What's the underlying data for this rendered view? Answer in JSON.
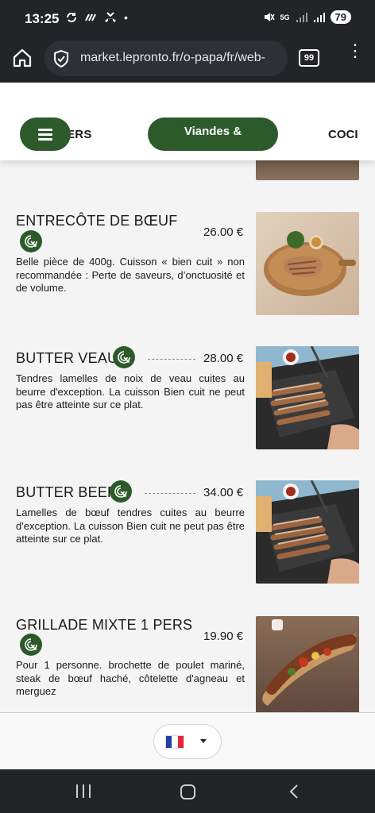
{
  "status": {
    "time": "13:25",
    "battery": "79",
    "network": "5G"
  },
  "browser": {
    "url": "market.lepronto.fr/o-papa/fr/web-",
    "tab_count": "99"
  },
  "categories": {
    "previous": "ERS",
    "active": "Viandes &",
    "next": "COCI"
  },
  "items": [
    {
      "title": "ENTRECÔTE DE BŒUF",
      "price": "26.00 €",
      "description": "Belle pièce de 400g. Cuisson « bien cuit » non recommandée : Perte de saveurs, d’onctuosité et de volume."
    },
    {
      "title": "BUTTER VEAU",
      "price": "28.00 €",
      "description": "Tendres lamelles de noix de veau cuites au beurre d'exception. La cuisson Bien cuit ne peut pas être atteinte sur ce plat."
    },
    {
      "title": "BUTTER BEEF",
      "price": "34.00 €",
      "description": "Lamelles de bœuf tendres cuites au beurre d'exception. La cuisson Bien cuit ne peut pas être atteinte sur ce plat."
    },
    {
      "title": "GRILLADE MIXTE 1 PERS",
      "price": "19.90 €",
      "description": "Pour 1 personne. brochette de poulet mariné, steak de bœuf haché, côtelette d'agneau et merguez"
    }
  ],
  "language": {
    "selected": "French",
    "icon": "france-flag"
  },
  "colors": {
    "brand_green": "#2d5a2b",
    "system_bar": "#232427"
  }
}
